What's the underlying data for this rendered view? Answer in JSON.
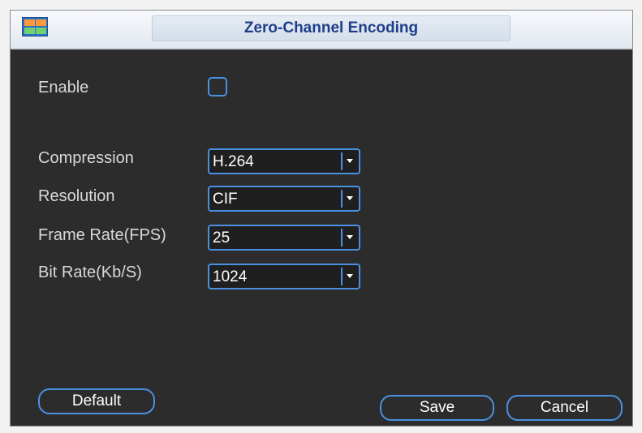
{
  "window": {
    "title": "Zero-Channel Encoding",
    "icon": "multi-view-grid-icon"
  },
  "fields": {
    "enable": {
      "label": "Enable",
      "checked": false
    },
    "compression": {
      "label": "Compression",
      "value": "H.264"
    },
    "resolution": {
      "label": "Resolution",
      "value": "CIF"
    },
    "frame_rate": {
      "label": "Frame Rate(FPS)",
      "value": "25"
    },
    "bit_rate": {
      "label": "Bit Rate(Kb/S)",
      "value": "1024"
    }
  },
  "buttons": {
    "default_label": "Default",
    "save_label": "Save",
    "cancel_label": "Cancel"
  },
  "colors": {
    "background": "#2c2c2c",
    "accent": "#4a90e2",
    "title_text": "#1f3f8a"
  }
}
